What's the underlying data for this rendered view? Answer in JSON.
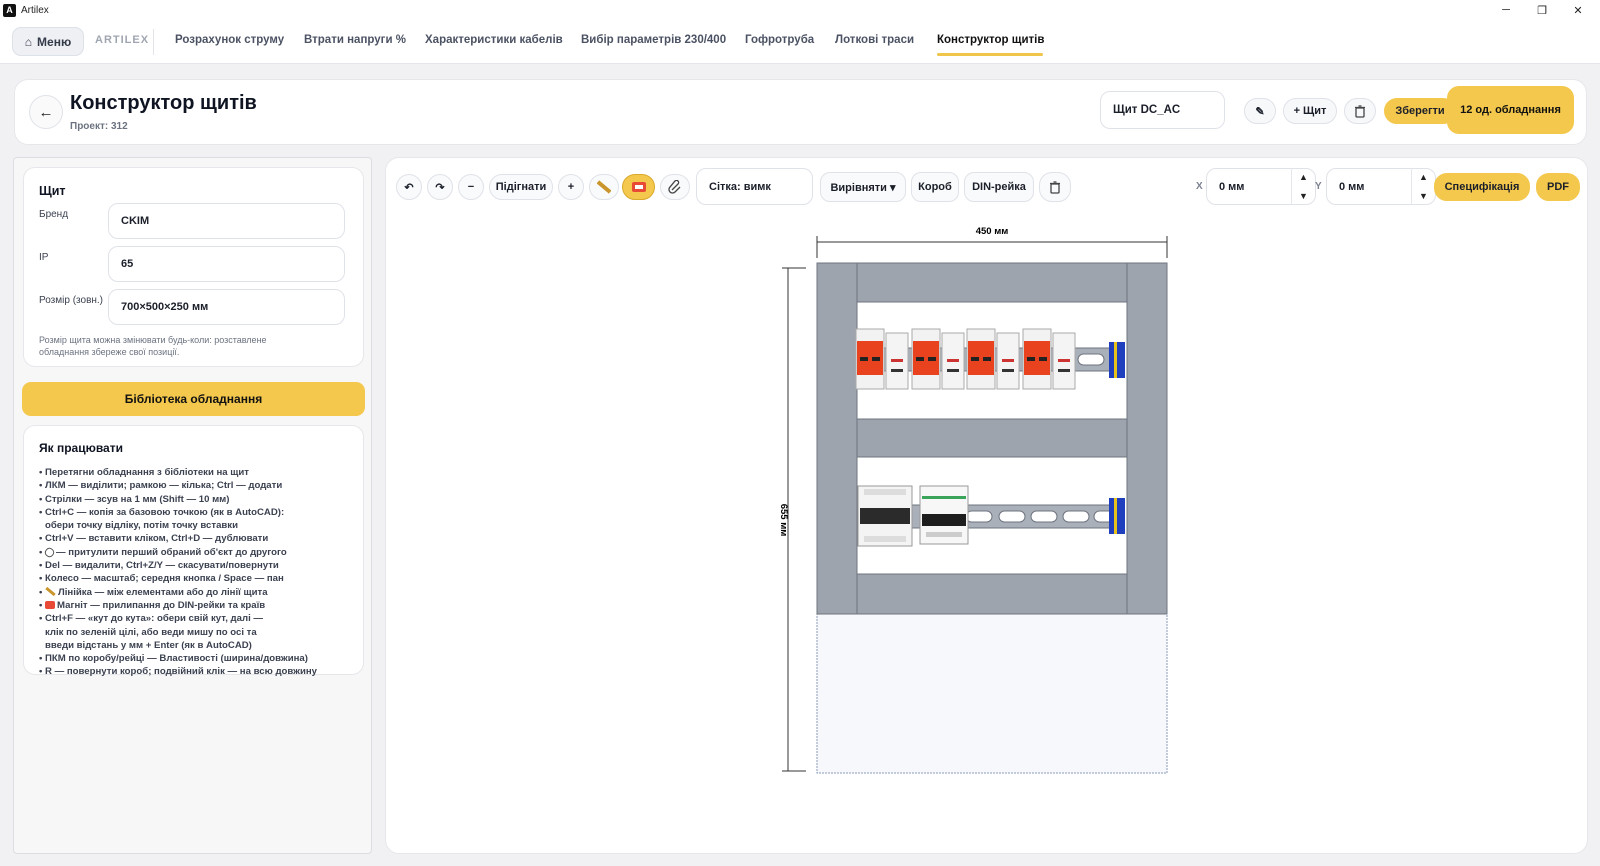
{
  "window": {
    "app_title": "Artilex",
    "minimize": "─",
    "maximize": "❐",
    "close": "✕"
  },
  "nav": {
    "menu_label": "Меню",
    "menu_icon": "⌂",
    "brand": "ARTILEX",
    "tabs": [
      "Розрахунок струму",
      "Втрати напруги %",
      "Характеристики кабелів",
      "Вибір параметрів 230/400",
      "Гофротруба",
      "Лоткові траси",
      "Конструктор щитів"
    ],
    "active_tab": "Конструктор щитів"
  },
  "header": {
    "back_icon": "←",
    "title": "Конструктор щитів",
    "subtitle": "Проект: 312",
    "panel_name": "Щит DC_AC",
    "rename_icon": "✎",
    "add_panel": "+ Щит",
    "save": "Зберегти",
    "equipment_count": "12 од. обладнання"
  },
  "sidebar": {
    "panel_card": {
      "title": "Щит",
      "brand_label": "Бренд",
      "brand_value": "CKIM",
      "ip_label": "IP",
      "ip_value": "65",
      "size_label": "Розмір (зовн.)",
      "size_value": "700×500×250 мм",
      "hint_line1": "Розмір щита можна змінювати будь-коли: розставлене",
      "hint_line2": "обладнання збереже свої позиції."
    },
    "library_button": "Бібліотека обладнання",
    "help": {
      "title": "Як працювати",
      "lines": [
        "• Перетягни обладнання з бібліотеки на щит",
        "• ЛКМ — виділити; рамкою — кілька; Ctrl — додати",
        "• Стрілки — зсув на 1 мм (Shift — 10 мм)",
        "• Ctrl+C — копія за базовою точкою (як в AutoCAD):",
        "  обери точку відліку, потім точку вставки",
        "• Ctrl+V — вставити кліком, Ctrl+D — дублювати",
        "— притулити перший обраний об'єкт до другого",
        "• Del — видалити, Ctrl+Z/Y — скасувати/повернути",
        "• Колесо — масштаб; середня кнопка / Space — пан",
        "Лінійка — між елементами або до лінії щита",
        "Магніт — прилипання до DIN-рейки та країв",
        "• Ctrl+F — «кут до кута»: обери свій кут, далі —",
        "  клік по зеленій цілі, або веди мишу по осі та",
        "  введи відстань у мм + Enter (як в AutoCAD)",
        "• ПКМ по коробу/рейці — Властивості (ширина/довжина)",
        "• R — повернути короб; подвійний клік — на всю довжину"
      ]
    }
  },
  "toolbar": {
    "undo": "↶",
    "redo": "↷",
    "zoom_out": "−",
    "fit": "Підігнати",
    "zoom_in": "+",
    "grid": "Сітка: вимк",
    "align": "Вирівняти ▾",
    "duct": "Короб",
    "din_rail": "DIN-рейка",
    "x_label": "X",
    "x_value": "0 мм",
    "y_label": "Y",
    "y_value": "0 мм",
    "spec": "Специфікація",
    "pdf": "PDF",
    "spin_up": "▲",
    "spin_down": "▼",
    "ruler_active": false,
    "magnet_active": true
  },
  "drawing": {
    "width_dim": "450 мм",
    "height_dim": "655 мм",
    "colors": {
      "duct": "#9ea4ae",
      "rail": "#aab0ba",
      "spd_red": "#e8421f",
      "end_clamp": "#1f3fbf",
      "end_clamp_yellow": "#e8c21a"
    },
    "row1_devices": [
      "spd",
      "breaker",
      "spd",
      "breaker",
      "spd",
      "breaker",
      "spd",
      "breaker"
    ],
    "row2_devices": [
      "rcbo-4p",
      "mcb-4p"
    ]
  }
}
